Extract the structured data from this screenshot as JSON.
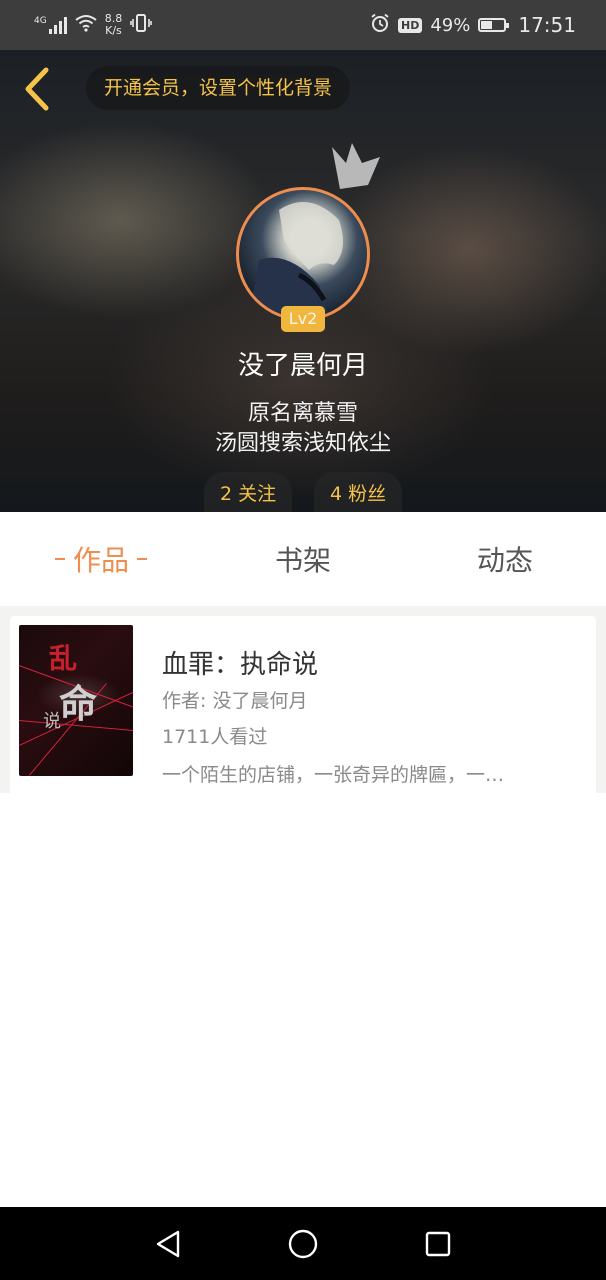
{
  "status_bar": {
    "signal": "4G",
    "speed_value": "8.8",
    "speed_unit": "K/s",
    "battery": "49%",
    "battery_level": 0.49,
    "time": "17:51",
    "hd": "HD"
  },
  "header": {
    "vip_banner": "开通会员，设置个性化背景",
    "level": "Lv2",
    "nickname": "没了晨何月",
    "bio_line1": "原名离慕雪",
    "bio_line2": "汤圆搜索浅知依尘",
    "following": "2 关注",
    "fans": "4 粉丝"
  },
  "tabs": {
    "works": "作品",
    "bookshelf": "书架",
    "activity": "动态"
  },
  "books": [
    {
      "title": "血罪：执命说",
      "author": "作者: 没了晨何月",
      "views": "1711人看过",
      "description": "一个陌生的店铺，一张奇异的牌匾，一…",
      "cover_text": "命"
    }
  ],
  "colors": {
    "accent": "#ee8d4d",
    "gold": "#f5c24a",
    "level_badge": "#f0b63d"
  }
}
